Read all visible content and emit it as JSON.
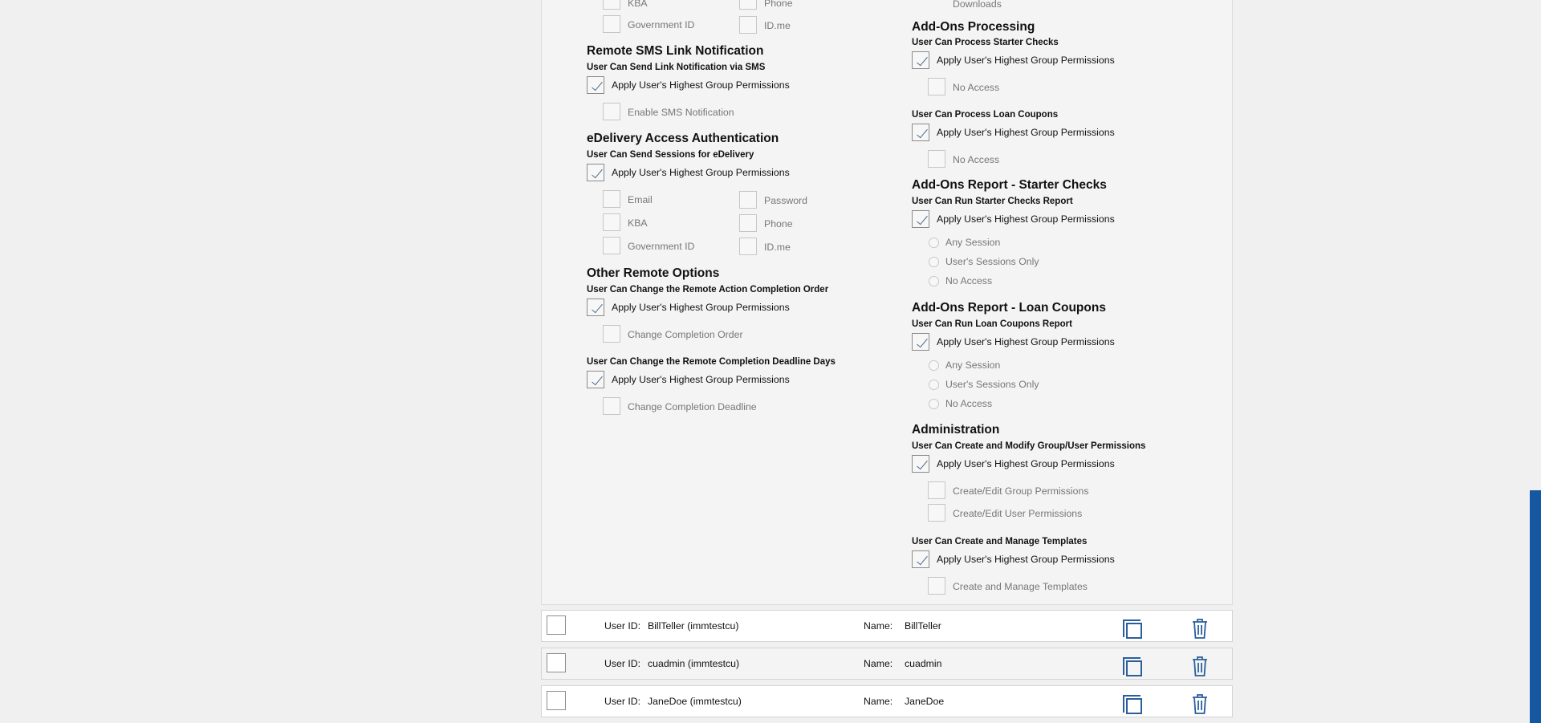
{
  "col_left": {
    "top_options": {
      "kba": "KBA",
      "phone": "Phone",
      "gov_id": "Government ID",
      "idme": "ID.me"
    },
    "sms": {
      "heading": "Remote SMS Link Notification",
      "sub": "User Can Send Link Notification via SMS",
      "apply": "Apply User's Highest Group Permissions",
      "enable": "Enable SMS Notification"
    },
    "edelivery": {
      "heading": "eDelivery Access Authentication",
      "sub": "User Can Send Sessions for eDelivery",
      "apply": "Apply User's Highest Group Permissions",
      "email": "Email",
      "password": "Password",
      "kba": "KBA",
      "phone": "Phone",
      "gov_id": "Government ID",
      "idme": "ID.me"
    },
    "other": {
      "heading": "Other Remote Options",
      "sub1": "User Can Change the Remote Action Completion Order",
      "apply1": "Apply User's Highest Group Permissions",
      "change_order": "Change Completion Order",
      "sub2": "User Can Change the Remote Completion Deadline Days",
      "apply2": "Apply User's Highest Group Permissions",
      "change_deadline": "Change Completion Deadline"
    }
  },
  "col_right": {
    "top_option": "Downloads",
    "processing": {
      "heading": "Add-Ons Processing",
      "sub1": "User Can Process Starter Checks",
      "apply1": "Apply User's Highest Group Permissions",
      "no_access1": "No Access",
      "sub2": "User Can Process Loan Coupons",
      "apply2": "Apply User's Highest Group Permissions",
      "no_access2": "No Access"
    },
    "report_starter": {
      "heading": "Add-Ons Report - Starter Checks",
      "sub": "User Can Run Starter Checks Report",
      "apply": "Apply User's Highest Group Permissions",
      "any": "Any Session",
      "own": "User's Sessions Only",
      "none": "No Access"
    },
    "report_loan": {
      "heading": "Add-Ons Report - Loan Coupons",
      "sub": "User Can Run Loan Coupons Report",
      "apply": "Apply User's Highest Group Permissions",
      "any": "Any Session",
      "own": "User's Sessions Only",
      "none": "No Access"
    },
    "admin": {
      "heading": "Administration",
      "sub1": "User Can Create and Modify Group/User Permissions",
      "apply1": "Apply User's Highest Group Permissions",
      "group": "Create/Edit Group Permissions",
      "user": "Create/Edit User Permissions",
      "sub2": "User Can Create and Manage Templates",
      "apply2": "Apply User's Highest Group Permissions",
      "templates": "Create and Manage Templates"
    }
  },
  "users": {
    "userid_label": "User ID:",
    "name_label": "Name:",
    "rows": [
      {
        "userid": "BillTeller (immtestcu)",
        "name": "BillTeller"
      },
      {
        "userid": "cuadmin (immtestcu)",
        "name": "cuadmin"
      },
      {
        "userid": "JaneDoe (immtestcu)",
        "name": "JaneDoe"
      }
    ]
  },
  "colors": {
    "accent": "#2a5f9c",
    "scrollbar": "#1557a0",
    "check": "#4f6d8c"
  }
}
